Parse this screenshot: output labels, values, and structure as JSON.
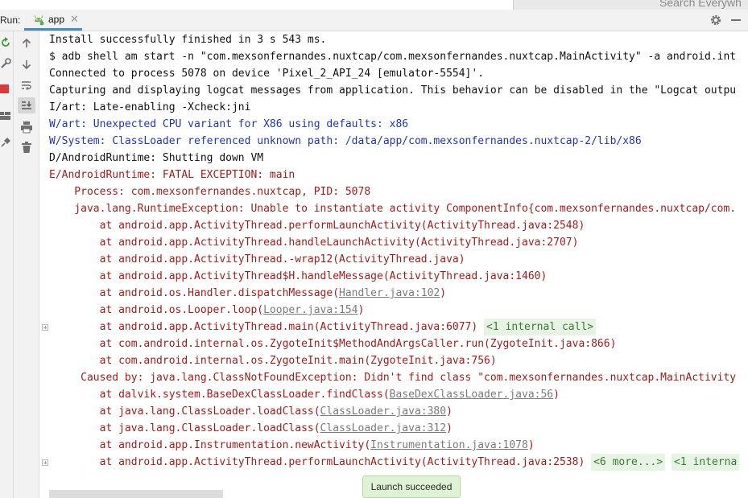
{
  "window": {
    "run_label": "Run:",
    "tab_label": "app",
    "search_placeholder": "Search Everywh"
  },
  "icons": {
    "tab": "android-icon",
    "tab_close": "close-icon",
    "settings": "gear-icon",
    "minimize": "minimize-icon",
    "left_bar": [
      "rerun-icon",
      "wrench-icon",
      "stop-icon",
      "layout-icon",
      "pin-icon"
    ],
    "actions": [
      "arrow-up-icon",
      "arrow-down-icon",
      "soft-wrap-icon",
      "scroll-to-end-icon",
      "print-icon",
      "trash-icon"
    ]
  },
  "colors": {
    "plain": "#111111",
    "warning": "#2436a8",
    "error": "#9a1b1b",
    "link": "#7a7a7a",
    "fold_bg": "#e7f3e5",
    "fold_fg": "#3b7a34",
    "toast_bg": "#dff2d6"
  },
  "console": {
    "lines": {
      "l0": "Install successfully finished in 3 s 543 ms.",
      "l1": "$ adb shell am start -n \"com.mexsonfernandes.nuxtcap/com.mexsonfernandes.nuxtcap.MainActivity\" -a android.int",
      "l2": "Connected to process 5078 on device 'Pixel_2_API_24 [emulator-5554]'.",
      "l3": "Capturing and displaying logcat messages from application. This behavior can be disabled in the \"Logcat outpu",
      "l4": "I/art: Late-enabling -Xcheck:jni",
      "l5": "W/art: Unexpected CPU variant for X86 using defaults: x86",
      "l6": "W/System: ClassLoader referenced unknown path: /data/app/com.mexsonfernandes.nuxtcap-2/lib/x86",
      "l7": "D/AndroidRuntime: Shutting down VM",
      "l8": "E/AndroidRuntime: FATAL EXCEPTION: main",
      "l9": "    Process: com.mexsonfernandes.nuxtcap, PID: 5078",
      "l10": "    java.lang.RuntimeException: Unable to instantiate activity ComponentInfo{com.mexsonfernandes.nuxtcap/com.",
      "l11": "        at android.app.ActivityThread.performLaunchActivity(ActivityThread.java:2548)",
      "l12": "        at android.app.ActivityThread.handleLaunchActivity(ActivityThread.java:2707)",
      "l13": "        at android.app.ActivityThread.-wrap12(ActivityThread.java)",
      "l14": "        at android.app.ActivityThread$H.handleMessage(ActivityThread.java:1460)",
      "l15a": "        at android.os.Handler.dispatchMessage(",
      "l15b": "Handler.java:102",
      "l15c": ")",
      "l16a": "        at android.os.Looper.loop(",
      "l16b": "Looper.java:154",
      "l16c": ")",
      "l17a": "        at android.app.ActivityThread.main(ActivityThread.java:6077) ",
      "l17b": "<1 internal call>",
      "l18": "        at com.android.internal.os.ZygoteInit$MethodAndArgsCaller.run(ZygoteInit.java:866)",
      "l19": "        at com.android.internal.os.ZygoteInit.main(ZygoteInit.java:756)",
      "l20": "     Caused by: java.lang.ClassNotFoundException: Didn't find class \"com.mexsonfernandes.nuxtcap.MainActivity",
      "l21a": "        at dalvik.system.BaseDexClassLoader.findClass(",
      "l21b": "BaseDexClassLoader.java:56",
      "l21c": ")",
      "l22a": "        at java.lang.ClassLoader.loadClass(",
      "l22b": "ClassLoader.java:380",
      "l22c": ")",
      "l23a": "        at java.lang.ClassLoader.loadClass(",
      "l23b": "ClassLoader.java:312",
      "l23c": ")",
      "l24a": "        at android.app.Instrumentation.newActivity(",
      "l24b": "Instrumentation.java:1078",
      "l24c": ")",
      "l25a": "        at android.app.ActivityThread.performLaunchActivity(ActivityThread.java:2538) ",
      "l25b": "<6 more...>",
      "l25c": " ",
      "l25d": "<1 interna"
    }
  },
  "toast": {
    "text": "Launch succeeded"
  }
}
